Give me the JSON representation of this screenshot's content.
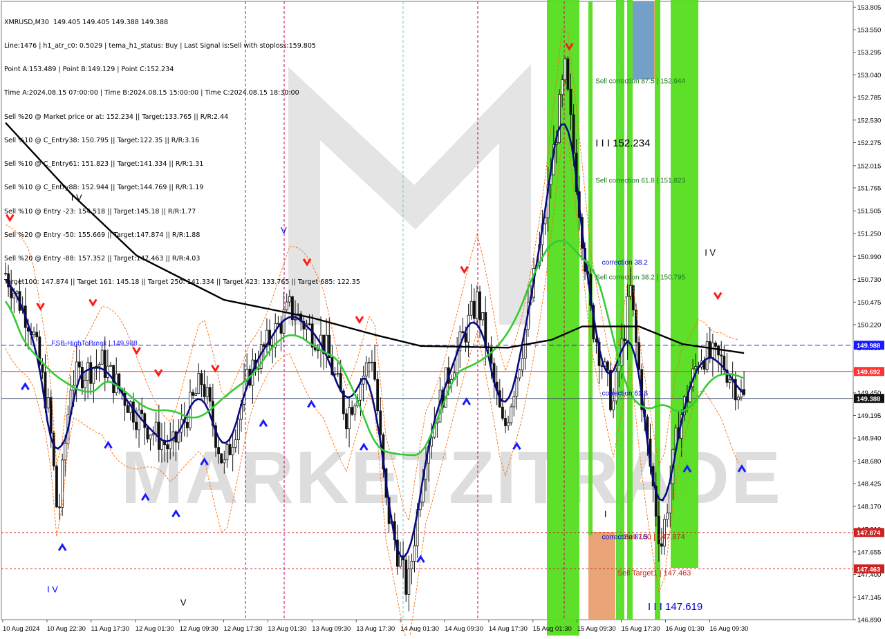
{
  "header": {
    "symbol_line": "XMRUSD,M30  149.405 149.405 149.388 149.388",
    "lines": [
      "Line:1476 | h1_atr_c0: 0.5029 | tema_h1_status: Buy | Last Signal is:Sell with stoploss:159.805",
      "Point A:153.489 | Point B:149.129 | Point C:152.234",
      "Time A:2024.08.15 07:00:00 | Time B:2024.08.15 15:00:00 | Time C:2024.08.15 18:30:00",
      "Sell %20 @ Market price or at: 152.234 || Target:133.765 || R/R:2.44",
      "Sell %10 @ C_Entry38: 150.795 || Target:122.35 || R/R:3.16",
      "Sell %10 @ C_Entry61: 151.823 || Target:141.334 || R/R:1.31",
      "Sell %10 @ C_Entry88: 152.944 || Target:144.769 || R/R:1.19",
      "Sell %10 @ Entry -23: 154.518 || Target:145.18 || R/R:1.77",
      "Sell %20 @ Entry -50: 155.669 || Target:147.874 || R/R:1.88",
      "Sell %20 @ Entry -88: 157.352 || Target:147.463 || R/R:4.03",
      "Target100: 147.874 || Target 161: 145.18 || Target 250: 141.334 || Target 423: 133.765 || Target 685: 122.35"
    ]
  },
  "watermark": "MARKETZITRADE",
  "chart_data": {
    "type": "candlestick",
    "symbol": "XMRUSD",
    "timeframe": "M30",
    "ylim": [
      146.89,
      153.87
    ],
    "y_ticks": [
      "153.805",
      "153.550",
      "153.295",
      "153.040",
      "152.785",
      "152.530",
      "152.275",
      "152.015",
      "151.765",
      "151.505",
      "151.250",
      "150.990",
      "150.730",
      "150.475",
      "150.220",
      "149.960",
      "149.705",
      "149.450",
      "149.195",
      "148.940",
      "148.680",
      "148.425",
      "148.170",
      "147.910",
      "147.655",
      "147.400",
      "147.145",
      "146.890"
    ],
    "x_ticks": [
      "10 Aug 2024",
      "10 Aug 22:30",
      "11 Aug 17:30",
      "12 Aug 01:30",
      "12 Aug 09:30",
      "12 Aug 17:30",
      "13 Aug 01:30",
      "13 Aug 09:30",
      "13 Aug 17:30",
      "14 Aug 01:30",
      "14 Aug 09:30",
      "14 Aug 17:30",
      "15 Aug 01:30",
      "15 Aug 09:30",
      "15 Aug 17:30",
      "16 Aug 01:30",
      "16 Aug 09:30"
    ],
    "price_badges": [
      {
        "value": "149.988",
        "color": "#1a1aff"
      },
      {
        "value": "149.692",
        "color": "#ff3333"
      },
      {
        "value": "149.388",
        "color": "#111111"
      },
      {
        "value": "147.874",
        "color": "#cc2222"
      },
      {
        "value": "147.463",
        "color": "#cc2222"
      }
    ],
    "horizontal_lines": [
      {
        "price": 149.988,
        "style": "dashed",
        "color": "#2222cc"
      },
      {
        "price": 149.692,
        "style": "solid",
        "color": "#ff3333"
      },
      {
        "price": 149.388,
        "style": "solid",
        "color": "#3a4a6a"
      },
      {
        "price": 147.874,
        "style": "dotted",
        "color": "#cc2222"
      },
      {
        "price": 147.463,
        "style": "dotted",
        "color": "#cc2222"
      }
    ],
    "annotations": [
      {
        "text": "I I I 152.234",
        "price": 152.234,
        "time": 13.5,
        "color": "#000000",
        "size": 15
      },
      {
        "text": "Sell correction 87.5 | 152.944",
        "price": 152.944,
        "time": 13.5,
        "color": "#1a7a1a",
        "size": 10
      },
      {
        "text": "Sell correction 61.8 | 151.823",
        "price": 151.823,
        "time": 13.5,
        "color": "#1a7a1a",
        "size": 10
      },
      {
        "text": "correction 38.2",
        "price": 150.9,
        "time": 13.65,
        "color": "#0000cc",
        "size": 10
      },
      {
        "text": "Sell correction 38.2 | 150.795",
        "price": 150.73,
        "time": 13.5,
        "color": "#1a7a1a",
        "size": 10
      },
      {
        "text": "FSB-HighToBreak | 149.988",
        "price": 149.988,
        "time": 1.05,
        "color": "#1a1aff",
        "size": 10
      },
      {
        "text": "correction 61.8",
        "price": 149.42,
        "time": 13.65,
        "color": "#0000cc",
        "size": 10
      },
      {
        "text": "correction 87.5",
        "price": 147.8,
        "time": 13.65,
        "color": "#0000cc",
        "size": 10
      },
      {
        "text": "Sell 100 | 147.874",
        "price": 147.8,
        "time": 14.15,
        "color": "#cc2222",
        "size": 11
      },
      {
        "text": "Sell Target1 | 147.463",
        "price": 147.39,
        "time": 14.0,
        "color": "#cc2222",
        "size": 11
      },
      {
        "text": "I I I 147.619",
        "price": 147.0,
        "time": 14.7,
        "color": "#0000cc",
        "size": 15
      },
      {
        "text": "I V",
        "price": 151.62,
        "time": 1.5,
        "color": "#000000",
        "size": 13
      },
      {
        "text": "V",
        "price": 151.25,
        "time": 6.3,
        "color": "#0000ff",
        "size": 13
      },
      {
        "text": "I V",
        "price": 151.0,
        "time": 16.0,
        "color": "#000000",
        "size": 13
      },
      {
        "text": "I V",
        "price": 147.2,
        "time": 0.95,
        "color": "#0000ff",
        "size": 13
      },
      {
        "text": "V",
        "price": 147.05,
        "time": 4.0,
        "color": "#000000",
        "size": 13
      },
      {
        "text": "I",
        "price": 148.05,
        "time": 13.7,
        "color": "#000000",
        "size": 13
      }
    ]
  }
}
